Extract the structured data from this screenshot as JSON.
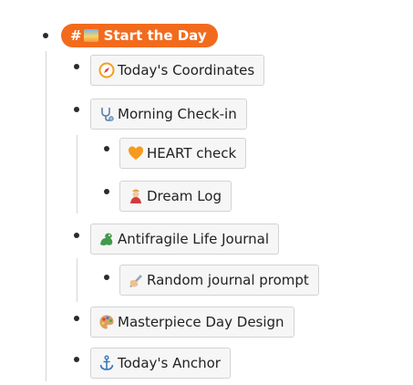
{
  "root": {
    "hash": "#",
    "label": "Start the Day"
  },
  "items": {
    "coordinates": "Today's Coordinates",
    "checkin": "Morning Check-in",
    "heart": "HEART check",
    "dream": "Dream Log",
    "journal": "Antifragile Life Journal",
    "prompt": "Random journal prompt",
    "masterpiece": "Masterpiece Day Design",
    "anchor": "Today's Anchor"
  },
  "colors": {
    "tag_bg": "#f26b1d",
    "chip_bg": "#f6f6f6",
    "chip_border": "#d3d3d3"
  },
  "icons": {
    "root": "sunrise-icon",
    "coordinates": "compass-icon",
    "checkin": "stethoscope-icon",
    "heart": "orange-heart-icon",
    "dream": "genie-icon",
    "journal": "dragon-icon",
    "prompt": "writing-hand-icon",
    "masterpiece": "palette-icon",
    "anchor": "anchor-icon"
  }
}
